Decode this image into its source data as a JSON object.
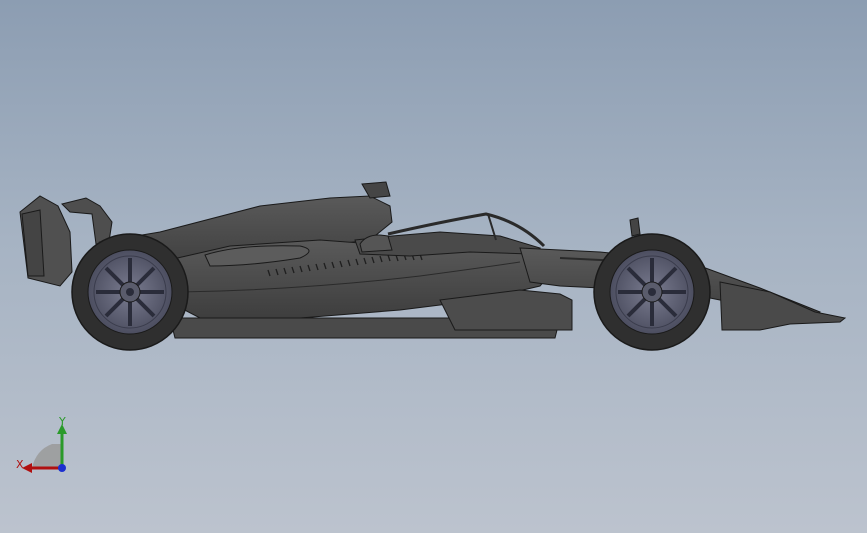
{
  "window": {
    "title": ""
  },
  "model": {
    "name": ""
  },
  "triad": {
    "x_label": "X",
    "y_label": "Y",
    "x_color": "#b01010",
    "y_color": "#2a9a2a",
    "z_color": "#1c2fd0"
  },
  "colors": {
    "background_top": "#8c9db2",
    "background_bottom": "#bcc3ce",
    "body": "#505050",
    "body_dark": "#3a3a3a",
    "rim": "#5c5e72",
    "tire": "#2f2f2f",
    "edge": "#1a1a1a"
  }
}
